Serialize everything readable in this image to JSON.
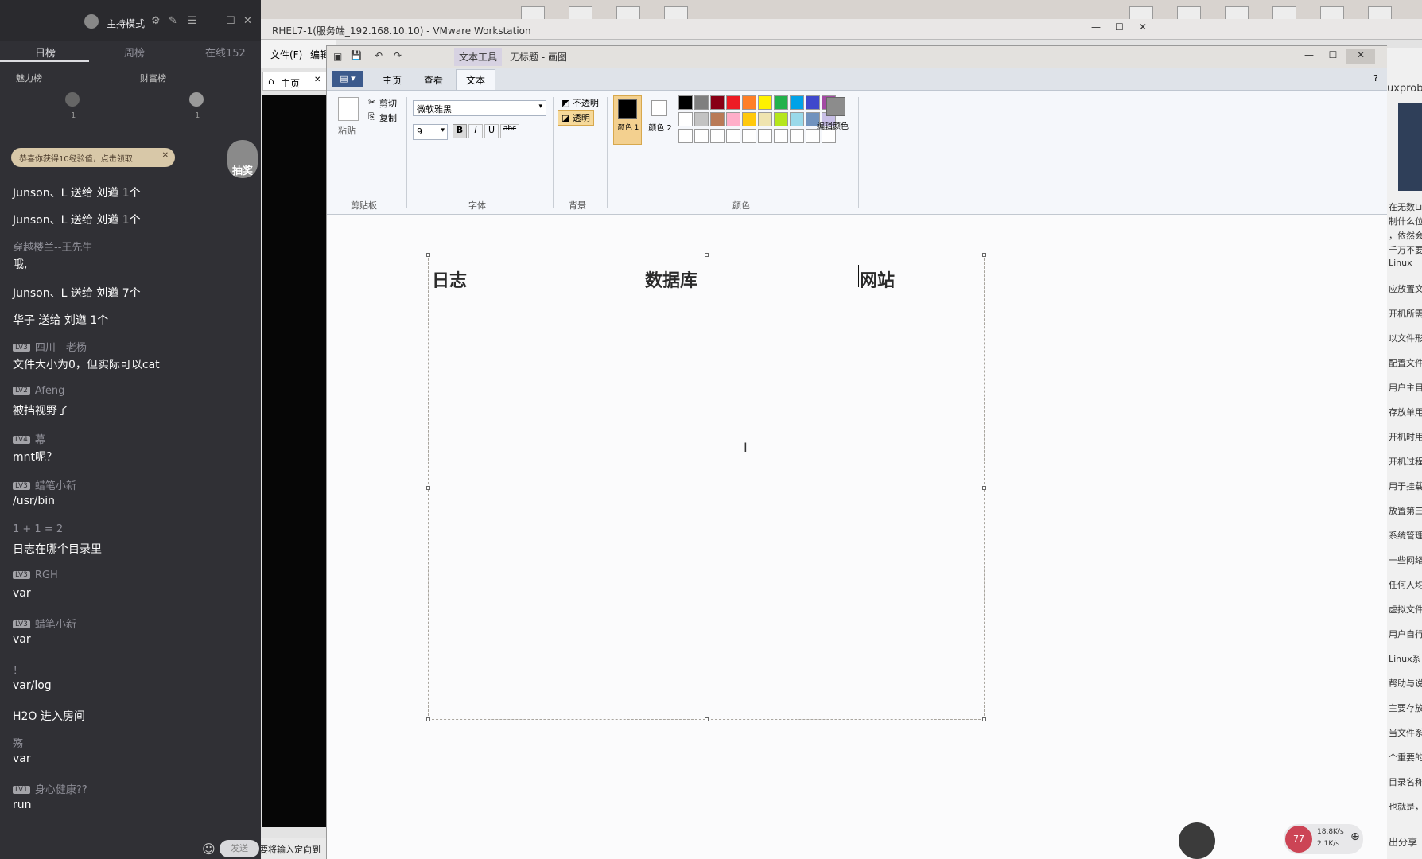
{
  "live_panel": {
    "mode_label": "主持模式",
    "tabs": [
      "日榜",
      "周榜",
      "在线152"
    ],
    "rank_labels": [
      "魅力榜",
      "财富榜"
    ],
    "rank_values": [
      "1",
      "1"
    ],
    "notice": "恭喜你获得10经验值，点击领取",
    "side_label": "抽奖",
    "messages": [
      {
        "name": "",
        "text": "Junson、L 送给 刘遒 1个"
      },
      {
        "name": "",
        "text": "Junson、L 送给 刘遒 1个"
      },
      {
        "name": "穿越楼兰--王先生",
        "text": "哦,"
      },
      {
        "name": "",
        "text": "Junson、L 送给 刘遒 7个"
      },
      {
        "name": "",
        "text": "华子 送给 刘遒 1个"
      },
      {
        "name": "四川—老杨",
        "badge": "LV3",
        "text": "文件大小为0，但实际可以cat"
      },
      {
        "name": "Afeng",
        "badge": "LV2",
        "text": "被挡视野了"
      },
      {
        "name": "幕",
        "badge": "LV4",
        "text": "mnt呢？"
      },
      {
        "name": "蜡笔小新",
        "badge": "LV3",
        "text": "/usr/bin"
      },
      {
        "name": "1 + 1 = 2",
        "text": "日志在哪个目录里"
      },
      {
        "name": "RGH",
        "badge": "LV3",
        "text": "var"
      },
      {
        "name": "蜡笔小新",
        "badge": "LV3",
        "text": "var"
      },
      {
        "name": "！",
        "text": "var/log"
      },
      {
        "name": "",
        "text": "H2O 进入房间"
      },
      {
        "name": "殇",
        "text": "var"
      },
      {
        "name": "身心健康??",
        "badge": "LV1",
        "text": "run"
      }
    ],
    "send_label": "发送"
  },
  "vmware": {
    "title": "RHEL7-1(服务端_192.168.10.10) - VMware Workstation",
    "menu": [
      "文件(F)",
      "编辑"
    ],
    "home_tab": "主页",
    "status_text": "要将输入定向到"
  },
  "paint": {
    "title_tools": "文本工具",
    "title": "无标题 - 画图",
    "tabs": [
      "主页",
      "查看",
      "文本"
    ],
    "clipboard": {
      "paste": "粘贴",
      "cut": "剪切",
      "copy": "复制",
      "group": "剪贴板"
    },
    "font": {
      "family": "微软雅黑",
      "size": "9",
      "group": "字体",
      "bold": "B",
      "italic": "I",
      "underline": "U",
      "strike": "abc"
    },
    "background": {
      "opaque": "不透明",
      "transparent": "透明",
      "group": "背景"
    },
    "colors": {
      "color1": "颜色 1",
      "color2": "颜色 2",
      "edit": "编辑颜色",
      "group": "颜色",
      "palette": [
        "#000000",
        "#7f7f7f",
        "#880015",
        "#ed1c24",
        "#ff7f27",
        "#fff200",
        "#22b14c",
        "#00a2e8",
        "#3f48cc",
        "#a349a4",
        "#ffffff",
        "#c3c3c3",
        "#b97a57",
        "#ffaec9",
        "#ffc90e",
        "#efe4b0",
        "#b5e61d",
        "#99d9ea",
        "#7092be",
        "#c8bfe7"
      ]
    },
    "canvas_texts": [
      "日志",
      "数据库",
      "网站"
    ]
  },
  "right_strip": {
    "header": "uxprobe",
    "lines": [
      "在无数Li",
      "制什么位",
      "，依然会",
      "千万不要",
      "Linux",
      "应放置文",
      "开机所需",
      "以文件形",
      "配置文件",
      "用户主目",
      "存放单用",
      "开机时用",
      "开机过程",
      "用于挂载",
      "放置第三",
      "系统管理",
      "一些网络",
      "任何人均",
      "虚拟文件",
      "用户自行",
      "Linux系",
      "帮助与说",
      "主要存放",
      "当文件系",
      "个重要的",
      "目录名称",
      "也就是，"
    ],
    "share": "出分享",
    "speed_up": "18.8K/s",
    "speed_down": "2.1K/s",
    "percent": "77"
  }
}
